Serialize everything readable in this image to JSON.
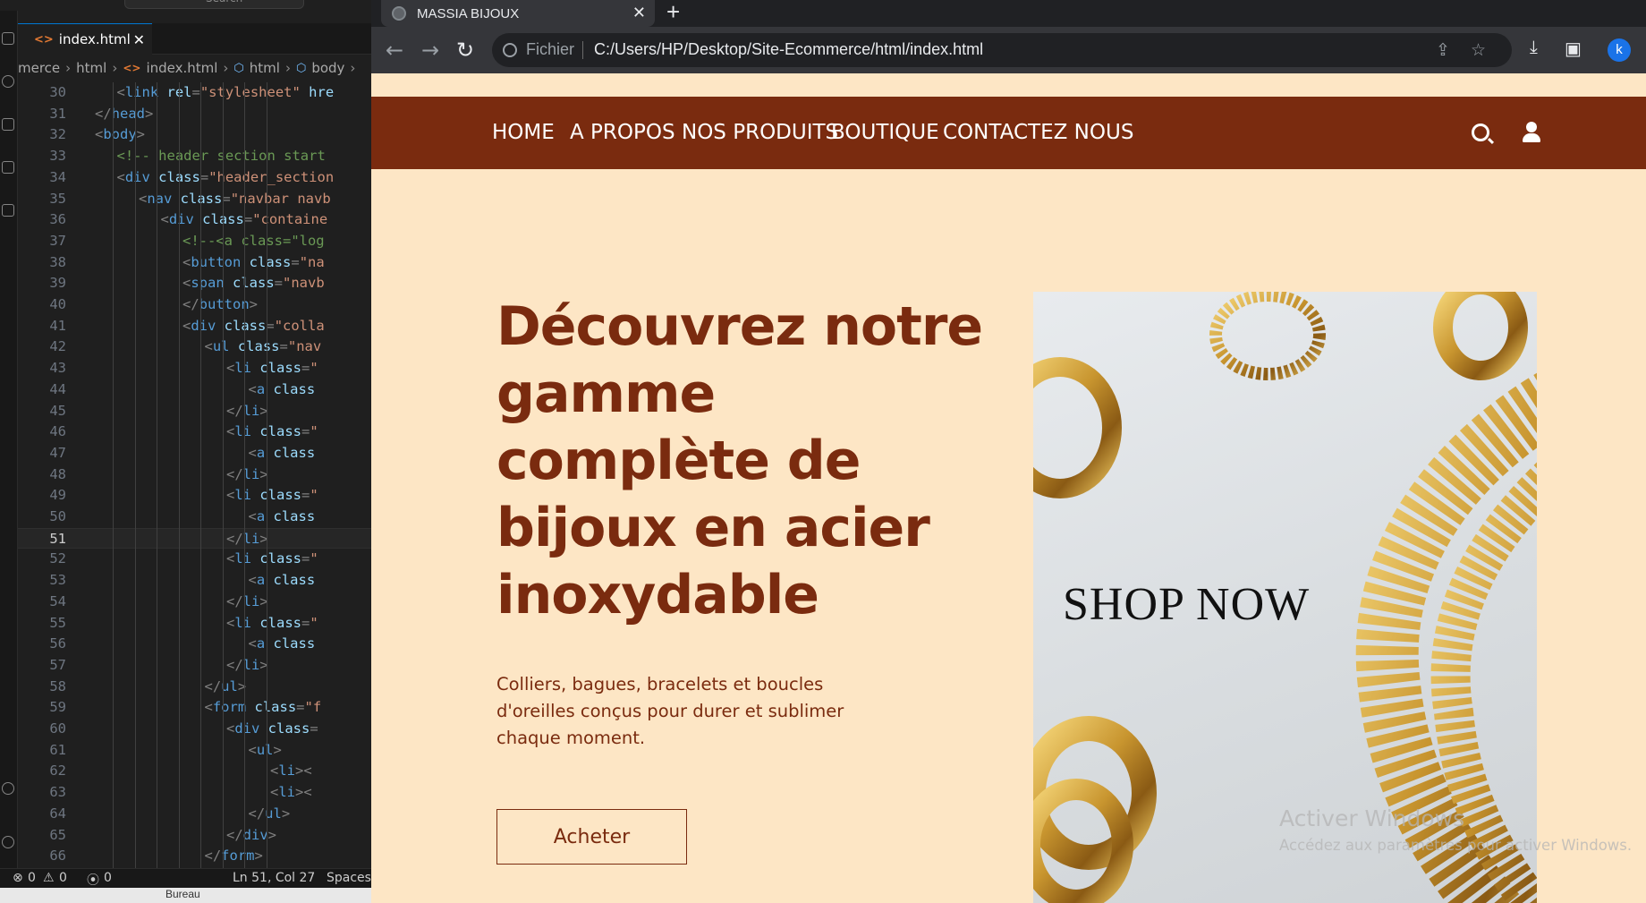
{
  "vscode": {
    "search_placeholder": "Search",
    "tab": {
      "icon": "<>",
      "label": "index.html",
      "close": "✕"
    },
    "breadcrumb": [
      "merce",
      "html",
      "index.html",
      "html",
      "body"
    ],
    "code_lines": [
      {
        "n": "30",
        "indent": 2,
        "parts": [
          [
            "pn",
            "<"
          ],
          [
            "tg",
            "link"
          ],
          [
            "at",
            " rel"
          ],
          [
            "pn",
            "="
          ],
          [
            "st",
            "\"stylesheet\""
          ],
          [
            "at",
            " hre"
          ]
        ]
      },
      {
        "n": "31",
        "indent": 1,
        "parts": [
          [
            "pn",
            "</"
          ],
          [
            "tg",
            "head"
          ],
          [
            "pn",
            ">"
          ]
        ]
      },
      {
        "n": "32",
        "indent": 1,
        "parts": [
          [
            "pn",
            "<"
          ],
          [
            "tg",
            "body"
          ],
          [
            "pn",
            ">"
          ]
        ]
      },
      {
        "n": "33",
        "indent": 2,
        "parts": [
          [
            "cm",
            "<!-- header section start"
          ]
        ]
      },
      {
        "n": "34",
        "indent": 2,
        "parts": [
          [
            "pn",
            "<"
          ],
          [
            "tg",
            "div"
          ],
          [
            "at",
            " class"
          ],
          [
            "pn",
            "="
          ],
          [
            "st",
            "\"header_section"
          ]
        ]
      },
      {
        "n": "35",
        "indent": 3,
        "parts": [
          [
            "pn",
            "<"
          ],
          [
            "tg",
            "nav"
          ],
          [
            "at",
            " class"
          ],
          [
            "pn",
            "="
          ],
          [
            "st",
            "\"navbar navb"
          ]
        ]
      },
      {
        "n": "36",
        "indent": 4,
        "parts": [
          [
            "pn",
            "<"
          ],
          [
            "tg",
            "div"
          ],
          [
            "at",
            " class"
          ],
          [
            "pn",
            "="
          ],
          [
            "st",
            "\"containe"
          ]
        ]
      },
      {
        "n": "37",
        "indent": 5,
        "parts": [
          [
            "cm",
            "<!--<a class=\"log"
          ]
        ]
      },
      {
        "n": "38",
        "indent": 5,
        "parts": [
          [
            "pn",
            "<"
          ],
          [
            "tg",
            "button"
          ],
          [
            "at",
            " class"
          ],
          [
            "pn",
            "="
          ],
          [
            "st",
            "\"na"
          ]
        ]
      },
      {
        "n": "39",
        "indent": 5,
        "parts": [
          [
            "pn",
            "<"
          ],
          [
            "tg",
            "span"
          ],
          [
            "at",
            " class"
          ],
          [
            "pn",
            "="
          ],
          [
            "st",
            "\"navb"
          ]
        ]
      },
      {
        "n": "40",
        "indent": 5,
        "parts": [
          [
            "pn",
            "</"
          ],
          [
            "tg",
            "button"
          ],
          [
            "pn",
            ">"
          ]
        ]
      },
      {
        "n": "41",
        "indent": 5,
        "parts": [
          [
            "pn",
            "<"
          ],
          [
            "tg",
            "div"
          ],
          [
            "at",
            " class"
          ],
          [
            "pn",
            "="
          ],
          [
            "st",
            "\"colla"
          ]
        ]
      },
      {
        "n": "42",
        "indent": 6,
        "parts": [
          [
            "pn",
            "<"
          ],
          [
            "tg",
            "ul"
          ],
          [
            "at",
            " class"
          ],
          [
            "pn",
            "="
          ],
          [
            "st",
            "\"nav"
          ]
        ]
      },
      {
        "n": "43",
        "indent": 7,
        "parts": [
          [
            "pn",
            "<"
          ],
          [
            "tg",
            "li"
          ],
          [
            "at",
            " class"
          ],
          [
            "pn",
            "="
          ],
          [
            "st",
            "\""
          ]
        ]
      },
      {
        "n": "44",
        "indent": 8,
        "parts": [
          [
            "pn",
            "<"
          ],
          [
            "tg",
            "a"
          ],
          [
            "at",
            " class"
          ]
        ]
      },
      {
        "n": "45",
        "indent": 7,
        "parts": [
          [
            "pn",
            "</"
          ],
          [
            "tg",
            "li"
          ],
          [
            "pn",
            ">"
          ]
        ]
      },
      {
        "n": "46",
        "indent": 7,
        "parts": [
          [
            "pn",
            "<"
          ],
          [
            "tg",
            "li"
          ],
          [
            "at",
            " class"
          ],
          [
            "pn",
            "="
          ],
          [
            "st",
            "\""
          ]
        ]
      },
      {
        "n": "47",
        "indent": 8,
        "parts": [
          [
            "pn",
            "<"
          ],
          [
            "tg",
            "a"
          ],
          [
            "at",
            " class"
          ]
        ]
      },
      {
        "n": "48",
        "indent": 7,
        "parts": [
          [
            "pn",
            "</"
          ],
          [
            "tg",
            "li"
          ],
          [
            "pn",
            ">"
          ]
        ]
      },
      {
        "n": "49",
        "indent": 7,
        "parts": [
          [
            "pn",
            "<"
          ],
          [
            "tg",
            "li"
          ],
          [
            "at",
            " class"
          ],
          [
            "pn",
            "="
          ],
          [
            "st",
            "\""
          ]
        ]
      },
      {
        "n": "50",
        "indent": 8,
        "parts": [
          [
            "pn",
            "<"
          ],
          [
            "tg",
            "a"
          ],
          [
            "at",
            " class"
          ]
        ]
      },
      {
        "n": "51",
        "indent": 7,
        "current": true,
        "parts": [
          [
            "pn",
            "</"
          ],
          [
            "tg",
            "li"
          ],
          [
            "pn",
            ">"
          ]
        ]
      },
      {
        "n": "52",
        "indent": 7,
        "parts": [
          [
            "pn",
            "<"
          ],
          [
            "tg",
            "li"
          ],
          [
            "at",
            " class"
          ],
          [
            "pn",
            "="
          ],
          [
            "st",
            "\""
          ]
        ]
      },
      {
        "n": "53",
        "indent": 8,
        "parts": [
          [
            "pn",
            "<"
          ],
          [
            "tg",
            "a"
          ],
          [
            "at",
            " class"
          ]
        ]
      },
      {
        "n": "54",
        "indent": 7,
        "parts": [
          [
            "pn",
            "</"
          ],
          [
            "tg",
            "li"
          ],
          [
            "pn",
            ">"
          ]
        ]
      },
      {
        "n": "55",
        "indent": 7,
        "parts": [
          [
            "pn",
            "<"
          ],
          [
            "tg",
            "li"
          ],
          [
            "at",
            " class"
          ],
          [
            "pn",
            "="
          ],
          [
            "st",
            "\""
          ]
        ]
      },
      {
        "n": "56",
        "indent": 8,
        "parts": [
          [
            "pn",
            "<"
          ],
          [
            "tg",
            "a"
          ],
          [
            "at",
            " class"
          ]
        ]
      },
      {
        "n": "57",
        "indent": 7,
        "parts": [
          [
            "pn",
            "</"
          ],
          [
            "tg",
            "li"
          ],
          [
            "pn",
            ">"
          ]
        ]
      },
      {
        "n": "58",
        "indent": 6,
        "parts": [
          [
            "pn",
            "</"
          ],
          [
            "tg",
            "ul"
          ],
          [
            "pn",
            ">"
          ]
        ]
      },
      {
        "n": "59",
        "indent": 6,
        "parts": [
          [
            "pn",
            "<"
          ],
          [
            "tg",
            "form"
          ],
          [
            "at",
            " class"
          ],
          [
            "pn",
            "="
          ],
          [
            "st",
            "\"f"
          ]
        ]
      },
      {
        "n": "60",
        "indent": 7,
        "parts": [
          [
            "pn",
            "<"
          ],
          [
            "tg",
            "div"
          ],
          [
            "at",
            " class"
          ],
          [
            "pn",
            "="
          ]
        ]
      },
      {
        "n": "61",
        "indent": 8,
        "parts": [
          [
            "pn",
            "<"
          ],
          [
            "tg",
            "ul"
          ],
          [
            "pn",
            ">"
          ]
        ]
      },
      {
        "n": "62",
        "indent": 9,
        "parts": [
          [
            "pn",
            "<"
          ],
          [
            "tg",
            "li"
          ],
          [
            "pn",
            ">"
          ],
          [
            "pn",
            "<"
          ]
        ]
      },
      {
        "n": "63",
        "indent": 9,
        "parts": [
          [
            "pn",
            "<"
          ],
          [
            "tg",
            "li"
          ],
          [
            "pn",
            ">"
          ],
          [
            "pn",
            "<"
          ]
        ]
      },
      {
        "n": "64",
        "indent": 8,
        "parts": [
          [
            "pn",
            "</"
          ],
          [
            "tg",
            "ul"
          ],
          [
            "pn",
            ">"
          ]
        ]
      },
      {
        "n": "65",
        "indent": 7,
        "parts": [
          [
            "pn",
            "</"
          ],
          [
            "tg",
            "div"
          ],
          [
            "pn",
            ">"
          ]
        ]
      },
      {
        "n": "66",
        "indent": 6,
        "parts": [
          [
            "pn",
            "</"
          ],
          [
            "tg",
            "form"
          ],
          [
            "pn",
            ">"
          ]
        ]
      }
    ],
    "status": {
      "errors": "0",
      "warnings": "0",
      "ports": "0",
      "position": "Ln 51, Col 27",
      "spaces": "Spaces:"
    },
    "taskbar_label": "Bureau"
  },
  "browser": {
    "tab_title": "MASSIA BIJOUX",
    "tab_close": "✕",
    "new_tab": "+",
    "scheme_label": "Fichier",
    "url": "C:/Users/HP/Desktop/Site-Ecommerce/html/index.html",
    "profile_initial": "k"
  },
  "site": {
    "nav": [
      "HOME",
      "A PROPOS",
      "NOS PRODUITS",
      "BOUTIQUE",
      "CONTACTEZ NOUS"
    ],
    "hero_title": "Découvrez notre gamme complète de bijoux en acier inoxydable",
    "hero_subtitle": "Colliers, bagues, bracelets et boucles d'oreilles conçus pour durer et sublimer chaque moment.",
    "buy_label": "Acheter",
    "image_text": "SHOP NOW",
    "colors": {
      "brand": "#7a2b0f",
      "background": "#fde6c5"
    }
  },
  "watermark": {
    "title": "Activer Windows",
    "subtitle": "Accédez aux paramètres pour activer Windows."
  }
}
